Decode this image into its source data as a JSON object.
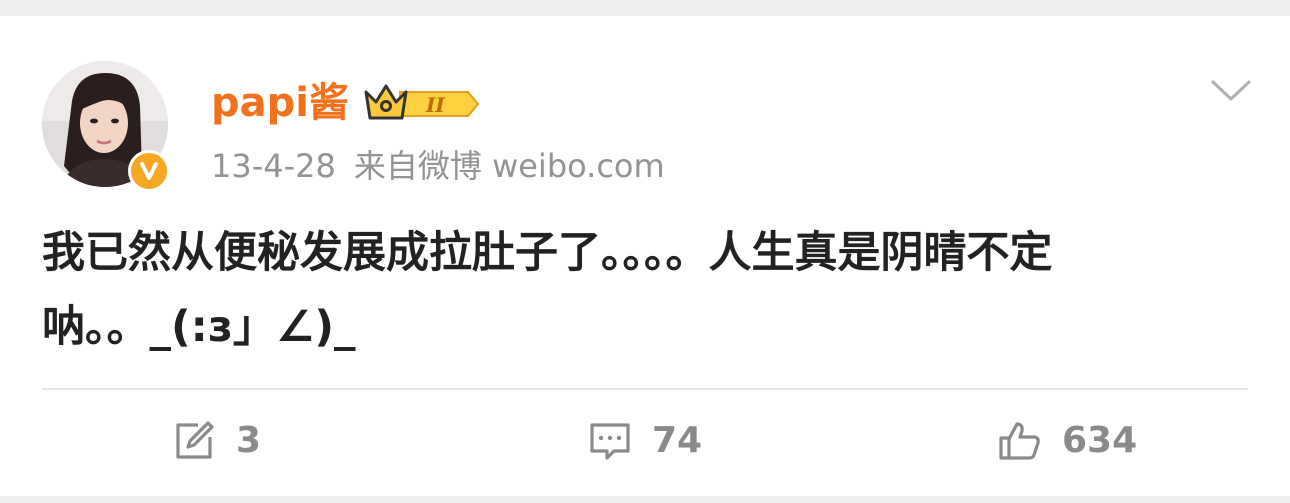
{
  "post": {
    "author": {
      "name": "papi酱",
      "avatar_icon": "user-avatar",
      "verified_icon": "verified-v-icon",
      "member_badge_icon": "crown-member-level-badge",
      "member_level": "II"
    },
    "meta": {
      "date": "13-4-28",
      "source": "来自微博 weibo.com"
    },
    "text_line1": "我已然从便秘发展成拉肚子了。。。。人生真是阴晴不定",
    "text_line2": "呐。。_(:з」∠)_",
    "menu_icon": "chevron-down-icon"
  },
  "actions": {
    "repost": {
      "icon": "share-icon",
      "count": "3"
    },
    "comment": {
      "icon": "comment-icon",
      "count": "74"
    },
    "like": {
      "icon": "thumbs-up-icon",
      "count": "634"
    }
  },
  "colors": {
    "username": "#f2711c",
    "meta": "#939393",
    "text": "#222222",
    "action": "#8a8a8a",
    "background": "#ededed",
    "card": "#ffffff",
    "badge_gold": "#f5a623"
  }
}
